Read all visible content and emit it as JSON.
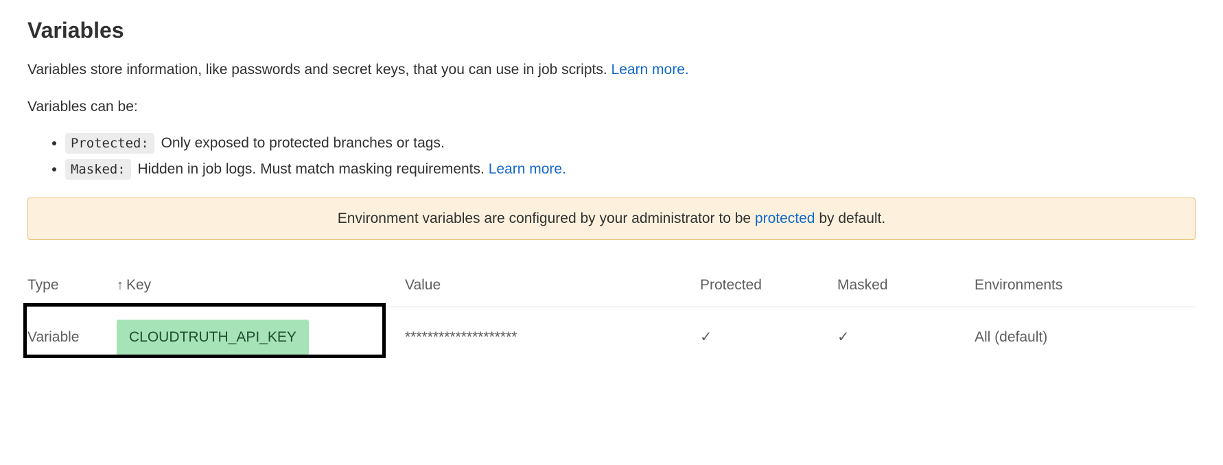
{
  "heading": "Variables",
  "description_prefix": "Variables store information, like passwords and secret keys, that you can use in job scripts. ",
  "learn_more": "Learn more.",
  "can_be_intro": "Variables can be:",
  "bullets": {
    "protected_label": "Protected:",
    "protected_desc": " Only exposed to protected branches or tags.",
    "masked_label": "Masked:",
    "masked_desc": " Hidden in job logs. Must match masking requirements. ",
    "masked_learn_more": "Learn more."
  },
  "banner": {
    "prefix": "Environment variables are configured by your administrator to be ",
    "link": "protected",
    "suffix": " by default."
  },
  "table": {
    "headers": {
      "type": "Type",
      "key": "Key",
      "value": "Value",
      "protected": "Protected",
      "masked": "Masked",
      "environments": "Environments"
    },
    "sort_arrow": "↑",
    "rows": [
      {
        "type": "Variable",
        "key": "CLOUDTRUTH_API_KEY",
        "value": "********************",
        "protected": "✓",
        "masked": "✓",
        "environments": "All (default)"
      }
    ]
  }
}
